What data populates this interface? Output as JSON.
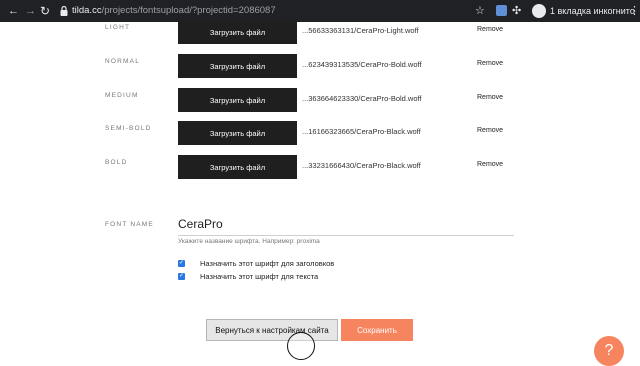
{
  "browser": {
    "url_host": "tilda.cc",
    "url_path": "/projects/fontsupload/?projectid=2086087",
    "profile_label": "1 вкладка инкогнито"
  },
  "fonts": {
    "rows": [
      {
        "weight": "LIGHT",
        "upload_label": "Загрузить файл",
        "filename": "...56633363131/CeraPro-Light.woff",
        "remove_label": "Remove"
      },
      {
        "weight": "NORMAL",
        "upload_label": "Загрузить файл",
        "filename": "...623439313535/CeraPro-Bold.woff",
        "remove_label": "Remove"
      },
      {
        "weight": "MEDIUM",
        "upload_label": "Загрузить файл",
        "filename": "...363664623330/CeraPro-Bold.woff",
        "remove_label": "Remove"
      },
      {
        "weight": "SEMI-BOLD",
        "upload_label": "Загрузить файл",
        "filename": "...16166323665/CeraPro-Black.woff",
        "remove_label": "Remove"
      },
      {
        "weight": "BOLD",
        "upload_label": "Загрузить файл",
        "filename": "...33231666430/CeraPro-Black.woff",
        "remove_label": "Remove"
      }
    ]
  },
  "font_name": {
    "label": "FONT NAME",
    "value": "CeraPro",
    "hint": "Укажите название шрифта. Например: proxima"
  },
  "options": {
    "headings_label": "Назначить этот шрифт для заголовков",
    "headings_checked": true,
    "text_label": "Назначить этот шрифт для текста",
    "text_checked": true
  },
  "actions": {
    "back_label": "Вернуться к настройкам сайта",
    "save_label": "Сохранить"
  },
  "colors": {
    "accent": "#f6845f",
    "checkbox": "#2b78e4",
    "button_dark": "#1f1f1f"
  }
}
